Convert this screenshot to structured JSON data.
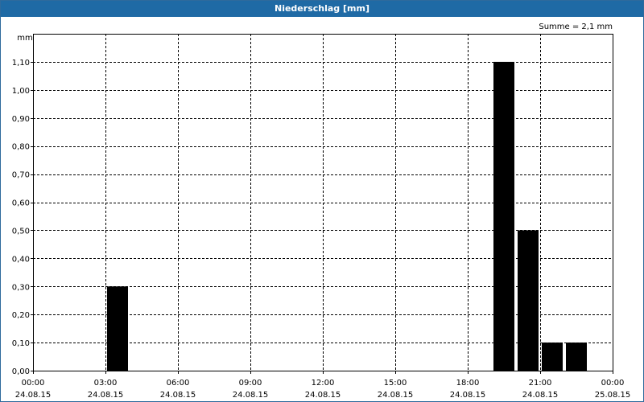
{
  "window": {
    "title": "Niederschlag [mm]"
  },
  "chart_data": {
    "type": "bar",
    "title": "Niederschlag [mm]",
    "ylabel": "mm",
    "annotation": "Summe = 2,1 mm",
    "ylim": [
      0,
      1.2
    ],
    "yticks": [
      0,
      0.1,
      0.2,
      0.3,
      0.4,
      0.5,
      0.6,
      0.7,
      0.8,
      0.9,
      1.0,
      1.1
    ],
    "ytick_labels": [
      "0,00",
      "0,10",
      "0,20",
      "0,30",
      "0,40",
      "0,50",
      "0,60",
      "0,70",
      "0,80",
      "0,90",
      "1,00",
      "1,10"
    ],
    "xlim_hours": [
      0,
      24
    ],
    "xticks": [
      {
        "h": 0,
        "time": "00:00",
        "date": "24.08.15"
      },
      {
        "h": 3,
        "time": "03:00",
        "date": "24.08.15"
      },
      {
        "h": 6,
        "time": "06:00",
        "date": "24.08.15"
      },
      {
        "h": 9,
        "time": "09:00",
        "date": "24.08.15"
      },
      {
        "h": 12,
        "time": "12:00",
        "date": "24.08.15"
      },
      {
        "h": 15,
        "time": "15:00",
        "date": "24.08.15"
      },
      {
        "h": 18,
        "time": "18:00",
        "date": "24.08.15"
      },
      {
        "h": 21,
        "time": "21:00",
        "date": "24.08.15"
      },
      {
        "h": 24,
        "time": "00:00",
        "date": "25.08.15"
      }
    ],
    "bars": [
      {
        "start_h": 3,
        "end_h": 4,
        "value": 0.3
      },
      {
        "start_h": 19,
        "end_h": 20,
        "value": 1.1
      },
      {
        "start_h": 20,
        "end_h": 21,
        "value": 0.5
      },
      {
        "start_h": 21,
        "end_h": 22,
        "value": 0.1
      },
      {
        "start_h": 22,
        "end_h": 23,
        "value": 0.1
      }
    ],
    "grid": true,
    "bar_color": "#000000"
  }
}
